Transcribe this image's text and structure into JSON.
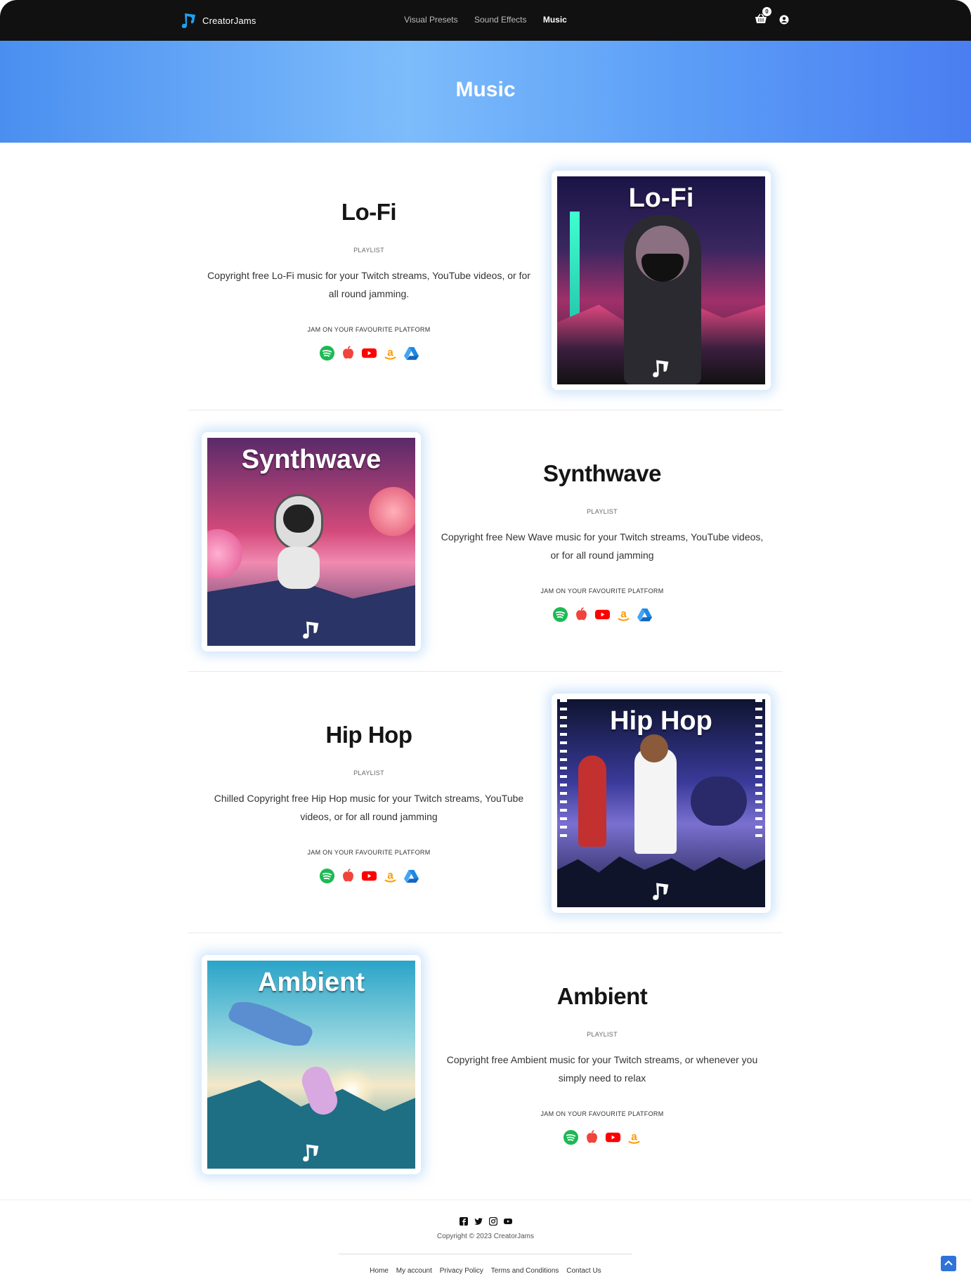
{
  "brand": {
    "name": "CreatorJams",
    "accent": "#1da1f2"
  },
  "nav": {
    "items": [
      "Visual Presets",
      "Sound Effects",
      "Music"
    ],
    "active": "Music"
  },
  "header": {
    "cart_count": "0",
    "cart_icon": "basket-icon",
    "account_icon": "user-circle-icon"
  },
  "hero": {
    "title": "Music"
  },
  "playlists": [
    {
      "title": "Lo-Fi",
      "subtitle": "PLAYLIST",
      "description": "Copyright free Lo-Fi music for your Twitch streams, YouTube videos, or for all round jamming.",
      "platform_label": "JAM ON YOUR FAVOURITE PLATFORM",
      "cover_title": "Lo-Fi",
      "platforms": [
        "spotify",
        "apple-music",
        "youtube",
        "amazon",
        "google-drive"
      ]
    },
    {
      "title": "Synthwave",
      "subtitle": "PLAYLIST",
      "description": "Copyright free New Wave music for your Twitch streams, YouTube videos, or for all round jamming",
      "platform_label": "JAM ON YOUR FAVOURITE PLATFORM",
      "cover_title": "Synthwave",
      "platforms": [
        "spotify",
        "apple-music",
        "youtube",
        "amazon",
        "google-drive"
      ]
    },
    {
      "title": "Hip Hop",
      "subtitle": "PLAYLIST",
      "description": "Chilled Copyright free Hip Hop music for your Twitch streams, YouTube videos, or for all round jamming",
      "platform_label": "JAM ON YOUR FAVOURITE PLATFORM",
      "cover_title": "Hip Hop",
      "platforms": [
        "spotify",
        "apple-music",
        "youtube",
        "amazon",
        "google-drive"
      ]
    },
    {
      "title": "Ambient",
      "subtitle": "PLAYLIST",
      "description": "Copyright free Ambient music for your Twitch streams, or whenever you simply need to relax",
      "platform_label": "JAM ON YOUR FAVOURITE PLATFORM",
      "cover_title": "Ambient",
      "platforms": [
        "spotify",
        "apple-music",
        "youtube",
        "amazon"
      ]
    }
  ],
  "footer": {
    "social": [
      "facebook-icon",
      "twitter-icon",
      "instagram-icon",
      "youtube-icon"
    ],
    "copyright": "Copyright © 2023 CreatorJams",
    "links": [
      "Home",
      "My account",
      "Privacy Policy",
      "Terms and Conditions",
      "Contact Us"
    ]
  },
  "colors": {
    "spotify": "#1db954",
    "apple": "#f0443c",
    "youtube": "#ff0000",
    "amazon": "#ff9900",
    "drive": "#1e88e5"
  }
}
